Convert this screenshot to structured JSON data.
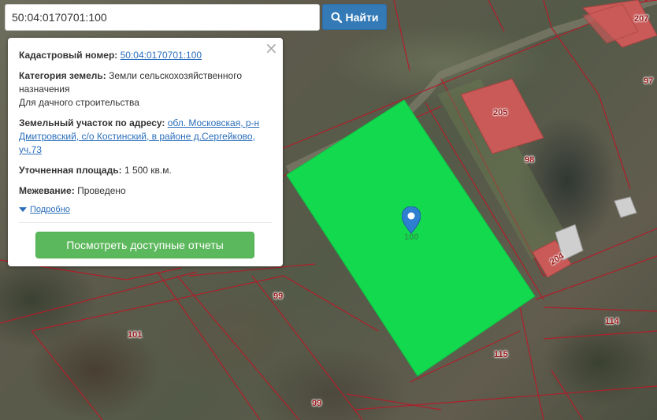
{
  "search": {
    "value": "50:04:0170701:100",
    "button_label": "Найти",
    "button_icon": "search-icon"
  },
  "popup": {
    "cadastral_label": "Кадастровый номер:",
    "cadastral_value": "50:04:0170701:100",
    "category_label": "Категория земель:",
    "category_value_1": "Земли сельскохозяйственного",
    "category_value_2": "назначения",
    "category_value_3": "Для дачного строительства",
    "address_label": "Земельный участок по адресу:",
    "address_line_1": "обл. Московская, р-н",
    "address_line_2": "Дмитровский, с/о Костинский, в районе д.Сергейково,",
    "address_line_3": "уч.73",
    "area_label": "Уточненная площадь:",
    "area_value": "1 500 кв.м.",
    "survey_label": "Межевание:",
    "survey_value": "Проведено",
    "more_label": "Подробно",
    "reports_button": "Посмотреть доступные отчеты",
    "close_icon": "close-icon"
  },
  "map": {
    "parcel_labels": {
      "p207": "207",
      "p97": "97",
      "p205": "205",
      "p98": "98",
      "p204": "204",
      "p99a": "99",
      "p101": "101",
      "p114": "114",
      "p115": "115",
      "p99b": "99"
    },
    "marker_label": "100",
    "highlight_color": "#12d94e",
    "boundary_color": "#b01e2a",
    "marker_color": "#2f7fd1"
  }
}
